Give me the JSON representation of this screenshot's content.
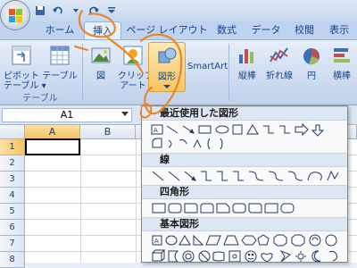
{
  "qat": {
    "icons": [
      "save-icon",
      "undo-icon",
      "redo-icon",
      "customize-icon"
    ]
  },
  "tabs": [
    {
      "label": "ホーム",
      "key": "home"
    },
    {
      "label": "挿入",
      "key": "insert",
      "active": true
    },
    {
      "label": "ページ レイアウト",
      "key": "page-layout"
    },
    {
      "label": "数式",
      "key": "formulas"
    },
    {
      "label": "データ",
      "key": "data"
    },
    {
      "label": "校閲",
      "key": "review"
    },
    {
      "label": "表示",
      "key": "view"
    }
  ],
  "ribbon": {
    "pivot_label": "ピボット\nテーブル ▾",
    "table_label": "テーブル",
    "group_table": "テーブル",
    "picture_label": "図",
    "clipart_label": "クリップ\nアート",
    "shapes_label": "図形",
    "smartart_label": "SmartArt",
    "column_label": "縦棒",
    "line_label": "折れ線",
    "pie_label": "円",
    "bar_label": "横棒"
  },
  "formula": {
    "namebox": "A1"
  },
  "grid": {
    "columns": [
      "A",
      "B"
    ],
    "rows": [
      "1",
      "2",
      "3",
      "4",
      "5",
      "6",
      "7",
      "8"
    ]
  },
  "shapes_menu": {
    "recent": "最近使用した図形",
    "lines": "線",
    "rectangles": "四角形",
    "basic": "基本図形"
  },
  "colors": {
    "annotation": "#e8862a",
    "ribbon_text": "#15428b",
    "grid_line": "#d0d7e5"
  }
}
